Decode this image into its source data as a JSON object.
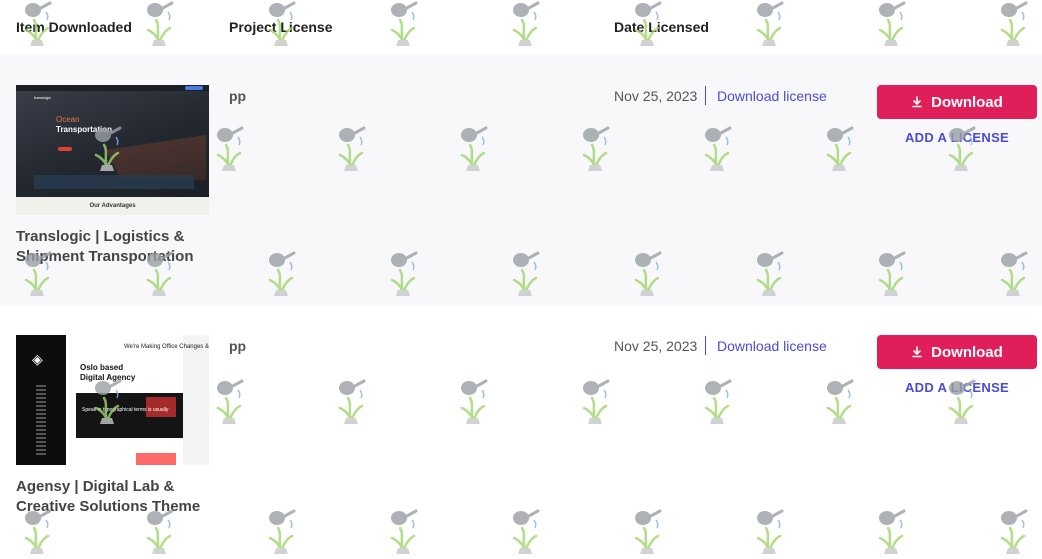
{
  "columns": {
    "item": "Item Downloaded",
    "project": "Project License",
    "date": "Date Licensed"
  },
  "items": [
    {
      "title": "Translogic | Logistics & Shipment Transportation",
      "project": "pp",
      "date": "Nov 25, 2023",
      "license_link": "Download license",
      "download_label": "Download",
      "add_license_label": "ADD A LICENSE",
      "thumb": {
        "logo": "translogic",
        "heading1": "Ocean",
        "heading2": "Transportation",
        "footer": "Our Advantages"
      }
    },
    {
      "title": "Agensy | Digital Lab & Creative Solutions Theme",
      "project": "pp",
      "date": "Nov 25, 2023",
      "license_link": "Download license",
      "download_label": "Download",
      "add_license_label": "ADD A LICENSE",
      "thumb": {
        "heading1": "Oslo based",
        "heading2": "Digital Agency",
        "topnote": "We're Making Office Changes &",
        "small": "Speak in typographical terms is usually"
      }
    }
  ],
  "colors": {
    "accent_button": "#e01e5a",
    "link": "#4b4bd6",
    "row_alt_bg": "#f8f8fb"
  },
  "icons": {
    "download": "download-icon",
    "watermark": "watering-can-icon"
  }
}
